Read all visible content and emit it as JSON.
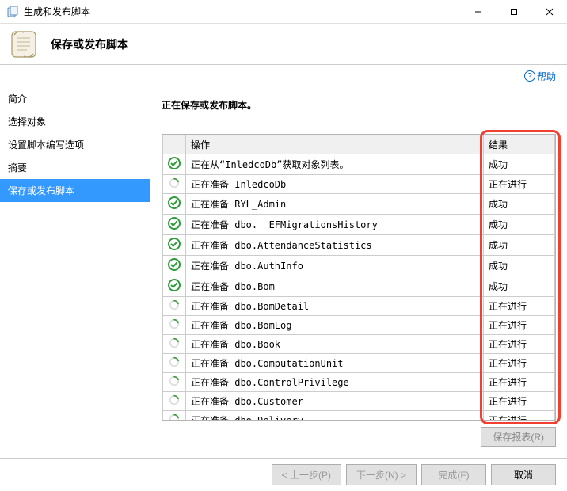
{
  "window": {
    "title": "生成和发布脚本"
  },
  "header": {
    "title": "保存或发布脚本"
  },
  "help": {
    "label": "帮助"
  },
  "sidebar": {
    "items": [
      {
        "label": "简介"
      },
      {
        "label": "选择对象"
      },
      {
        "label": "设置脚本编写选项"
      },
      {
        "label": "摘要"
      },
      {
        "label": "保存或发布脚本"
      }
    ],
    "activeIndex": 4
  },
  "content": {
    "title": "正在保存或发布脚本。",
    "columns": {
      "action": "操作",
      "result": "结果"
    },
    "rows": [
      {
        "status": "success",
        "action": "正在从“InledcoDb”获取对象列表。",
        "result": "成功"
      },
      {
        "status": "progress",
        "action": "正在准备 InledcoDb",
        "result": "正在进行"
      },
      {
        "status": "success",
        "action": "正在准备 RYL_Admin",
        "result": "成功"
      },
      {
        "status": "success",
        "action": "正在准备 dbo.__EFMigrationsHistory",
        "result": "成功"
      },
      {
        "status": "success",
        "action": "正在准备 dbo.AttendanceStatistics",
        "result": "成功"
      },
      {
        "status": "success",
        "action": "正在准备 dbo.AuthInfo",
        "result": "成功"
      },
      {
        "status": "success",
        "action": "正在准备 dbo.Bom",
        "result": "成功"
      },
      {
        "status": "progress",
        "action": "正在准备 dbo.BomDetail",
        "result": "正在进行"
      },
      {
        "status": "progress",
        "action": "正在准备 dbo.BomLog",
        "result": "正在进行"
      },
      {
        "status": "progress",
        "action": "正在准备 dbo.Book",
        "result": "正在进行"
      },
      {
        "status": "progress",
        "action": "正在准备 dbo.ComputationUnit",
        "result": "正在进行"
      },
      {
        "status": "progress",
        "action": "正在准备 dbo.ControlPrivilege",
        "result": "正在进行"
      },
      {
        "status": "progress",
        "action": "正在准备 dbo.Customer",
        "result": "正在进行"
      },
      {
        "status": "progress",
        "action": "正在准备 dbo.Delivery",
        "result": "正在进行"
      }
    ]
  },
  "buttons": {
    "saveReport": "保存报表(R)",
    "prev": "< 上一步(P)",
    "next": "下一步(N) >",
    "finish": "完成(F)",
    "cancel": "取消"
  }
}
